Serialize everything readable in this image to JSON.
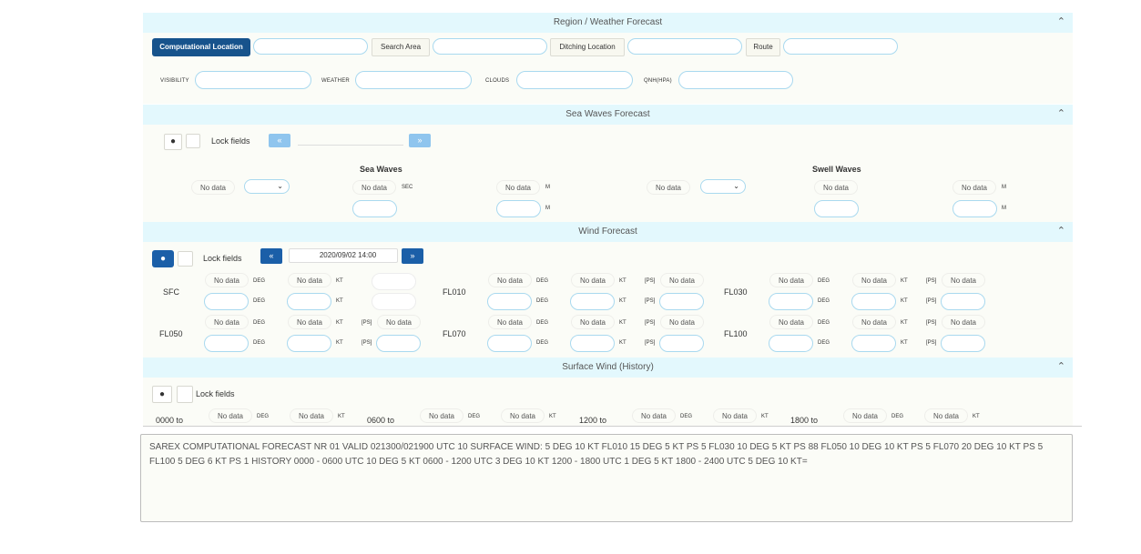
{
  "region": {
    "title": "Region / Weather Forecast",
    "computational_location": "Computational Location",
    "search_area": "Search Area",
    "ditching_location": "Ditching Location",
    "route": "Route",
    "visibility": "VISIBILITY",
    "weather": "WEATHER",
    "clouds": "CLOUDS",
    "qnh": "QNH(HPA)"
  },
  "sea": {
    "title": "Sea Waves Forecast",
    "lock": "Lock fields",
    "sea_waves": "Sea Waves",
    "swell_waves": "Swell Waves",
    "no_data": "No data",
    "sec": "SEC",
    "m": "M"
  },
  "wind": {
    "title": "Wind Forecast",
    "lock": "Lock fields",
    "datetime": "2020/09/02 14:00",
    "no_data": "No data",
    "deg": "DEG",
    "kt": "KT",
    "ps": "[PS]",
    "levels": [
      "SFC",
      "FL010",
      "FL030",
      "FL050",
      "FL070",
      "FL100"
    ]
  },
  "surface": {
    "title": "Surface Wind (History)",
    "lock": "Lock fields",
    "no_data": "No data",
    "deg": "DEG",
    "kt": "KT",
    "periods": [
      "0000 to",
      "0600 to",
      "1200 to",
      "1800 to"
    ]
  },
  "output_text": "SAREX COMPUTATIONAL FORECAST NR 01 VALID 021300/021900 UTC 10 SURFACE WIND: 5 DEG 10 KT FL010 15 DEG 5 KT PS 5 FL030 10 DEG 5 KT PS 88 FL050 10 DEG 10 KT PS 5 FL070 20 DEG 10 KT PS 5 FL100 5 DEG 6 KT PS 1 HISTORY 0000 - 0600 UTC 10 DEG 5 KT 0600 - 1200 UTC 3 DEG 10 KT 1200 - 1800 UTC 1 DEG 5 KT 1800 - 2400 UTC 5 DEG 10 KT=",
  "icons": {
    "collapse": "chevron-up-icon",
    "globe": "globe-icon",
    "prev": "double-left-icon",
    "next": "double-right-icon",
    "dropdown": "chevron-down-icon"
  },
  "colors": {
    "primary": "#17538c",
    "header_bg": "#e3f8fd",
    "input_border": "#a9d9ef"
  }
}
